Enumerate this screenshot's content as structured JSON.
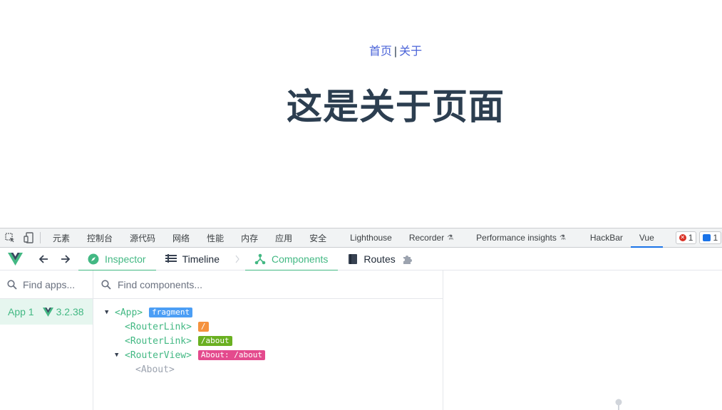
{
  "webpage": {
    "nav": {
      "home": "首页",
      "separator": "|",
      "about": "关于"
    },
    "heading": "这是关于页面"
  },
  "devtools": {
    "tabs": [
      "元素",
      "控制台",
      "源代码",
      "网络",
      "性能",
      "内存",
      "应用",
      "安全",
      "Lighthouse",
      "Recorder",
      "Performance insights",
      "HackBar",
      "Vue"
    ],
    "active_tab": "Vue",
    "error_count": "1",
    "message_count": "1",
    "icons": [
      "inspect-element-icon",
      "device-toolbar-icon",
      "flask-icon",
      "error-icon",
      "message-icon"
    ]
  },
  "vue": {
    "toolbar": {
      "inspector": "Inspector",
      "timeline": "Timeline",
      "components": "Components",
      "routes": "Routes"
    },
    "apps": {
      "search_placeholder": "Find apps...",
      "app_name": "App 1",
      "app_version": "3.2.38"
    },
    "components": {
      "search_placeholder": "Find components...",
      "tree": [
        {
          "label": "<App>",
          "badge": "fragment",
          "badge_color": "#4b9ef5",
          "expanded": true
        },
        {
          "label": "<RouterLink>",
          "badge": "/",
          "badge_color": "#f5923e"
        },
        {
          "label": "<RouterLink>",
          "badge": "/about",
          "badge_color": "#6ab021"
        },
        {
          "label": "<RouterView>",
          "badge": "About: /about",
          "badge_color": "#e44a8d",
          "expanded": true
        },
        {
          "label": "<About>"
        }
      ]
    },
    "colors": {
      "accent": "#42b883",
      "text": "#2c3e50",
      "link": "#4a63d8"
    }
  }
}
